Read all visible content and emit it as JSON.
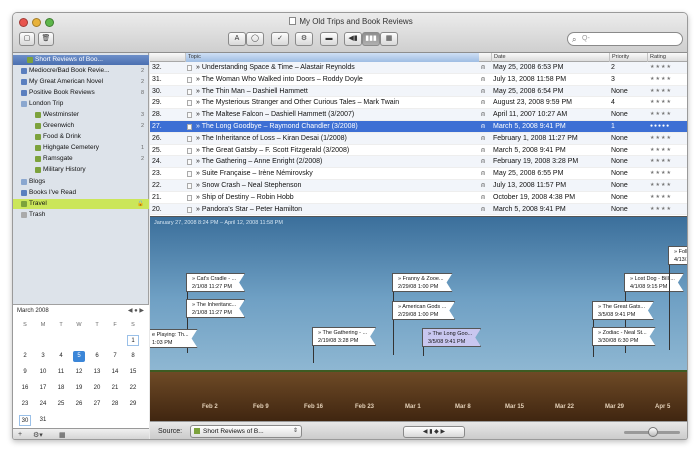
{
  "window": {
    "title": "My Old Trips and Book Reviews"
  },
  "toolbar": {
    "buttons": [
      "A",
      "◯",
      "✓",
      "⚙",
      "▬",
      "◀▮",
      "▮▮▮",
      "▦"
    ],
    "search_placeholder": "Q-"
  },
  "sidebar": {
    "items": [
      {
        "label": "Short Reviews of Boo...",
        "count": "",
        "color": "#7ca23c"
      },
      {
        "label": "Mediocre/Bad Book Revie...",
        "count": "2",
        "color": "#5a7fbf"
      },
      {
        "label": "My Great American Novel",
        "count": "2",
        "color": "#5a7fbf"
      },
      {
        "label": "Positive Book Reviews",
        "count": "8",
        "color": "#5a7fbf"
      },
      {
        "label": "London Trip",
        "count": "",
        "color": "#8aa7cf"
      },
      {
        "label": "Westminster",
        "count": "3",
        "color": "#7ca23c"
      },
      {
        "label": "Greenwich",
        "count": "2",
        "color": "#7ca23c"
      },
      {
        "label": "Food & Drink",
        "count": "",
        "color": "#7ca23c"
      },
      {
        "label": "Highgate Cemetery",
        "count": "1",
        "color": "#7ca23c"
      },
      {
        "label": "Ramsgate",
        "count": "2",
        "color": "#7ca23c"
      },
      {
        "label": "Military History",
        "count": "",
        "color": "#7ca23c"
      },
      {
        "label": "Blogs",
        "count": "",
        "color": "#8aa7cf"
      },
      {
        "label": "Books I've Read",
        "count": "",
        "color": "#5a7fbf"
      },
      {
        "label": "Travel",
        "count": "",
        "color": "#7ca23c"
      },
      {
        "label": "Trash",
        "count": "",
        "color": "#aaaaaa"
      }
    ]
  },
  "calendar": {
    "month": "March 2008",
    "dow": [
      "S",
      "M",
      "T",
      "W",
      "T",
      "F",
      "S"
    ],
    "weeks": [
      [
        "",
        "",
        "",
        "",
        "",
        "",
        "1"
      ],
      [
        "2",
        "3",
        "4",
        "5",
        "6",
        "7",
        "8"
      ],
      [
        "9",
        "10",
        "11",
        "12",
        "13",
        "14",
        "15"
      ],
      [
        "16",
        "17",
        "18",
        "19",
        "20",
        "21",
        "22"
      ],
      [
        "23",
        "24",
        "25",
        "26",
        "27",
        "28",
        "29"
      ],
      [
        "30",
        "31",
        "",
        "",
        "",
        "",
        ""
      ]
    ],
    "today": "5"
  },
  "table": {
    "columns": [
      "Topic",
      "Date",
      "Priority",
      "Rating"
    ],
    "rows": [
      {
        "n": "32.",
        "topic": "» Understanding Space & Time – Alastair Reynolds",
        "date": "May 25, 2008 6:53 PM",
        "priority": "2"
      },
      {
        "n": "31.",
        "topic": "» The Woman Who Walked into Doors – Roddy Doyle",
        "date": "July 13, 2008 11:58 PM",
        "priority": "3"
      },
      {
        "n": "30.",
        "topic": "» The Thin Man – Dashiell Hammett",
        "date": "May 25, 2008 6:54 PM",
        "priority": "None"
      },
      {
        "n": "29.",
        "topic": "» The Mysterious Stranger and Other Curious Tales – Mark Twain",
        "date": "August 23, 2008 9:59 PM",
        "priority": "4"
      },
      {
        "n": "28.",
        "topic": "» The Maltese Falcon – Dashiell Hammett (3/2007)",
        "date": "April 11, 2007 10:27 AM",
        "priority": "None"
      },
      {
        "n": "27.",
        "topic": "» The Long Goodbye – Raymond Chandler (3/2008)",
        "date": "March 5, 2008 9:41 PM",
        "priority": "1"
      },
      {
        "n": "26.",
        "topic": "» The Inheritance of Loss – Kiran Desai (1/2008)",
        "date": "February 1, 2008 11:27 PM",
        "priority": "None"
      },
      {
        "n": "25.",
        "topic": "» The Great Gatsby – F. Scott Fitzgerald (3/2008)",
        "date": "March 5, 2008 9:41 PM",
        "priority": "None"
      },
      {
        "n": "24.",
        "topic": "» The Gathering – Anne Enright (2/2008)",
        "date": "February 19, 2008 3:28 PM",
        "priority": "None"
      },
      {
        "n": "23.",
        "topic": "» Suite Française – Irène Némirovsky",
        "date": "May 25, 2008 6:55 PM",
        "priority": "None"
      },
      {
        "n": "22.",
        "topic": "» Snow Crash – Neal Stephenson",
        "date": "July 13, 2008 11:57 PM",
        "priority": "None"
      },
      {
        "n": "21.",
        "topic": "» Ship of Destiny – Robin Hobb",
        "date": "October 19, 2008 4:38 PM",
        "priority": "None"
      },
      {
        "n": "20.",
        "topic": "» Pandora's Star – Peter Hamilton",
        "date": "March 5, 2008 9:41 PM",
        "priority": "None"
      }
    ]
  },
  "timeline": {
    "range": "January 27, 2008 8:24 PM – April 12, 2008 11:58 PM",
    "ticks": [
      "Feb 2",
      "Feb 9",
      "Feb 16",
      "Feb 23",
      "Mar 1",
      "Mar 8",
      "Mar 15",
      "Mar 22",
      "Mar 29",
      "Apr 5"
    ],
    "flags": [
      {
        "t": "» Cat's Cradle - ...",
        "d": "2/1/08 11:27 PM"
      },
      {
        "t": "» The Inheritanc...",
        "d": "2/1/08 11:27 PM"
      },
      {
        "t": "e Playing: Th...",
        "d": "1:03 PM"
      },
      {
        "t": "» The Gathering - ...",
        "d": "2/19/08 3:28 PM"
      },
      {
        "t": "» Franny & Zooe...",
        "d": "2/29/08 1:00 PM"
      },
      {
        "t": "» American Gods ...",
        "d": "2/29/08 1:00 PM"
      },
      {
        "t": "» The Long Goo...",
        "d": "3/5/08 9:41 PM"
      },
      {
        "t": "» Lost Dog - Bill ...",
        "d": "4/1/08 9:15 PM"
      },
      {
        "t": "» The Great Gats...",
        "d": "3/5/08 9:41 PM"
      },
      {
        "t": "» Zodiac - Neal St...",
        "d": "3/30/08 6:30 PM"
      },
      {
        "t": "» Foll...",
        "d": "4/13/..."
      }
    ]
  },
  "bottombar": {
    "source_label": "Source:",
    "source_value": "Short Reviews of B...",
    "nav": "◀  ▮  ◆  ▶"
  }
}
